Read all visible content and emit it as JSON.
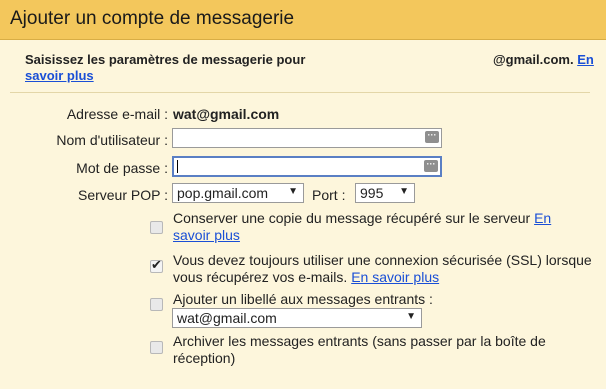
{
  "title": "Ajouter un compte de messagerie",
  "intro": {
    "text": "Saisissez les paramètres de messagerie pour",
    "suffix": "@gmail.com.",
    "suffix_link": "En",
    "more_link": "savoir plus"
  },
  "form": {
    "email_label": "Adresse e-mail :",
    "email_value": "wat@gmail.com",
    "username_label": "Nom d'utilisateur :",
    "username_value": "",
    "password_label": "Mot de passe :",
    "password_value": "",
    "pop_label": "Serveur POP :",
    "pop_value": "pop.gmail.com",
    "port_label": "Port :",
    "port_value": "995"
  },
  "options": {
    "keep_copy": {
      "checked": false,
      "text": "Conserver une copie du message récupéré sur le serveur",
      "link_a": "En",
      "link_b": "savoir plus"
    },
    "ssl": {
      "checked": true,
      "text_a": "Vous devez toujours utiliser une connexion sécurisée (SSL) lorsque",
      "text_b": "vous récupérez vos e-mails.",
      "link": "En savoir plus"
    },
    "label": {
      "checked": false,
      "text": "Ajouter un libellé aux messages entrants :",
      "select_value": "wat@gmail.com"
    },
    "archive": {
      "checked": false,
      "text_a": "Archiver les messages entrants (sans passer par la boîte de",
      "text_b": "réception)"
    }
  },
  "icons": {
    "password_manager": "password-manager-icon",
    "dropdown": "chevron-down-icon",
    "check": "check-icon"
  },
  "colors": {
    "titlebar": "#f3c75c",
    "panel": "#fdf6dc",
    "link": "#1a4fd6"
  }
}
